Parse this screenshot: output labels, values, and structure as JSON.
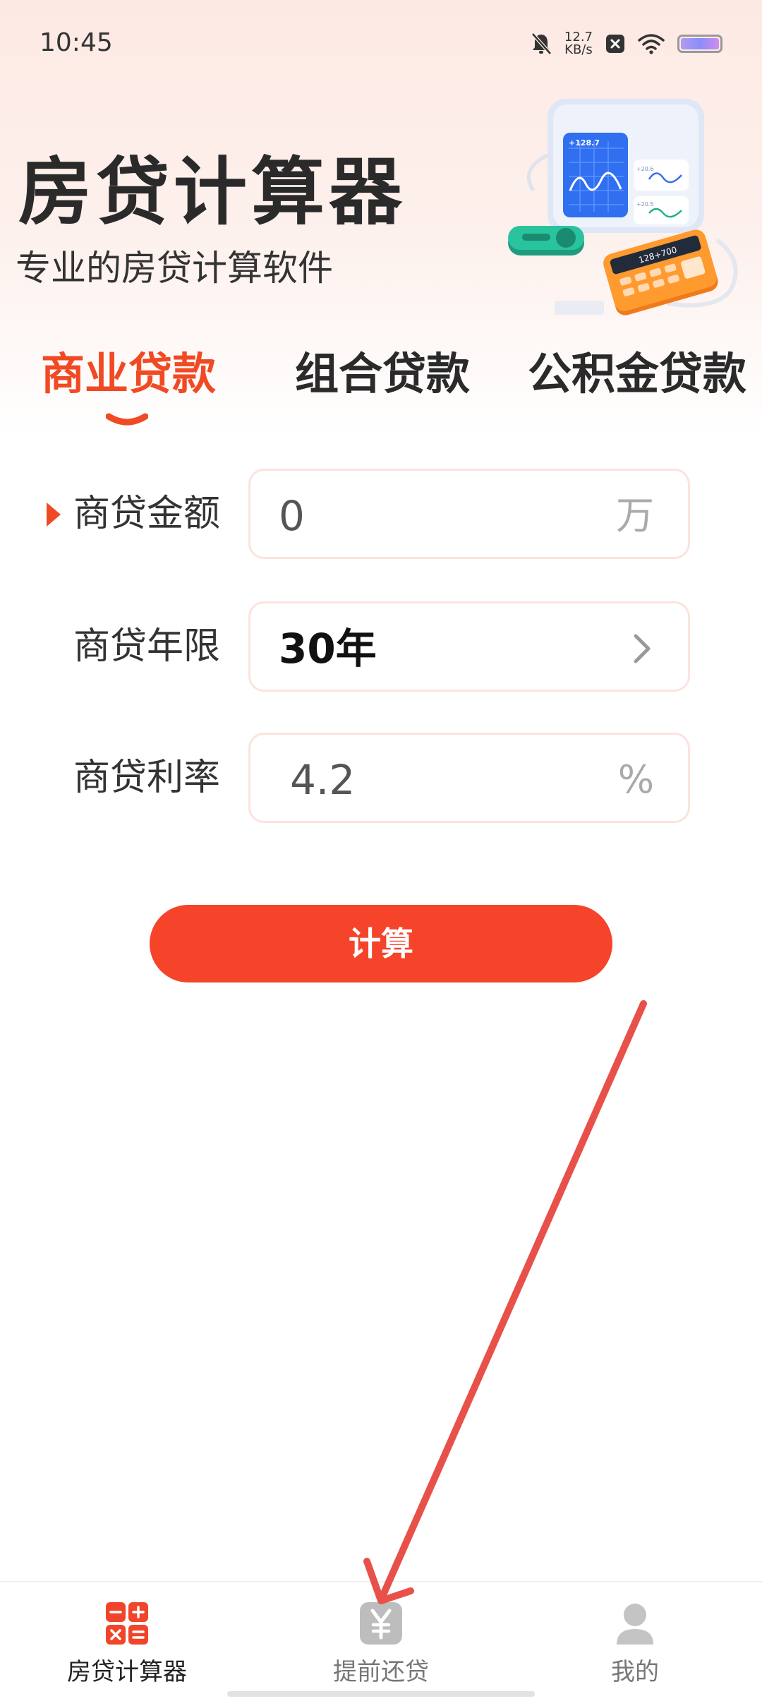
{
  "status_bar": {
    "time": "10:45",
    "net_speed_value": "12.7",
    "net_speed_unit": "KB/s",
    "icons": [
      "bell-muted-icon",
      "close-box-icon",
      "wifi-icon",
      "battery-icon"
    ]
  },
  "header": {
    "title": "房贷计算器",
    "subtitle": "专业的房贷计算软件",
    "illustration": {
      "icon": "calculator-dashboard-illustration",
      "screen_label": "+128.7",
      "card_top_label": "+20.6",
      "card_bottom_label": "+20.5",
      "calculator_label": "128+700"
    }
  },
  "tabs": [
    {
      "label": "商业贷款",
      "active": true
    },
    {
      "label": "组合贷款",
      "active": false
    },
    {
      "label": "公积金贷款",
      "active": false
    }
  ],
  "form": {
    "amount": {
      "label": "商贷金额",
      "value": "0",
      "unit": "万"
    },
    "term": {
      "label": "商贷年限",
      "value": "30年",
      "icon": "chevron-right-icon"
    },
    "rate": {
      "label": "商贷利率",
      "value": "4.2",
      "unit": "%"
    }
  },
  "calculate_button": {
    "label": "计算"
  },
  "bottom_nav": [
    {
      "label": "房贷计算器",
      "icon": "calculator-icon",
      "active": true
    },
    {
      "label": "提前还贷",
      "icon": "yen-icon",
      "active": false
    },
    {
      "label": "我的",
      "icon": "user-icon",
      "active": false
    }
  ],
  "colors": {
    "accent": "#f04a24",
    "button": "#f5442a",
    "annotation_arrow": "#e8514a"
  }
}
